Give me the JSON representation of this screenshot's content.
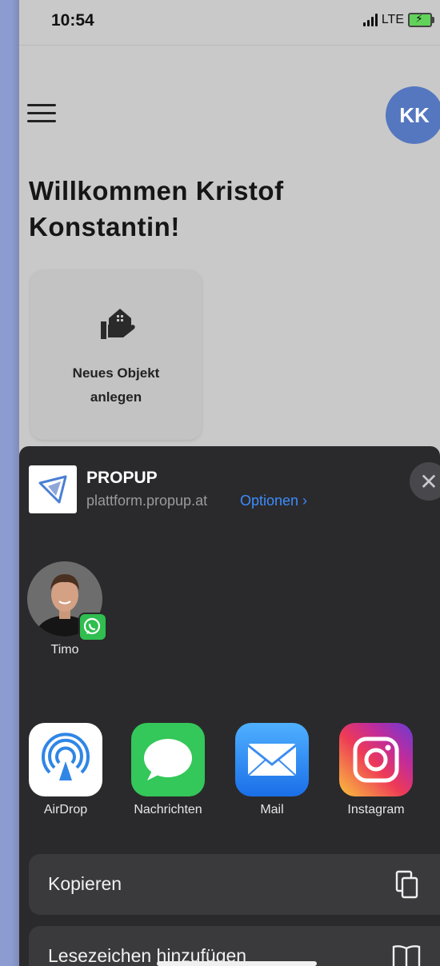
{
  "status_bar": {
    "time": "10:54",
    "network": "LTE"
  },
  "header": {
    "avatar_initials": "KK"
  },
  "main": {
    "welcome_text": "Willkommen Kristof Konstantin!",
    "tile_label": "Neues Objekt\nanlegen"
  },
  "share_sheet": {
    "app_name": "PROPUP",
    "app_url": "plattform.propup.at",
    "options_label": "Optionen ›",
    "close_symbol": "✕",
    "contacts": [
      {
        "name": "Timo",
        "badge_icon": "whatsapp-icon"
      }
    ],
    "apps": [
      {
        "label": "AirDrop",
        "icon": "airdrop-icon"
      },
      {
        "label": "Nachrichten",
        "icon": "messages-icon"
      },
      {
        "label": "Mail",
        "icon": "mail-icon"
      },
      {
        "label": "Instagram",
        "icon": "instagram-icon"
      }
    ],
    "actions": [
      {
        "label": "Kopieren",
        "icon": "copy-icon"
      },
      {
        "label": "Lesezeichen hinzufügen",
        "icon": "book-icon"
      }
    ]
  },
  "colors": {
    "accent": "#3d8bfd",
    "avatar": "#5577c0",
    "sheet_background": "#2a2a2c",
    "whatsapp": "#2fbe4f"
  }
}
